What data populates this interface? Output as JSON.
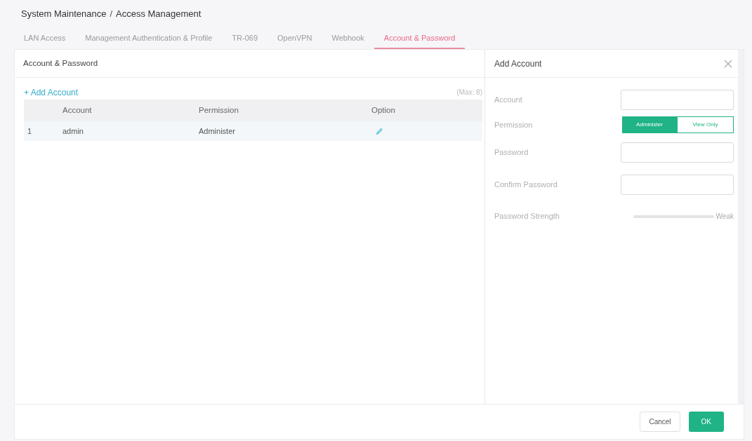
{
  "breadcrumb": {
    "items": [
      "System Maintenance",
      "Access Management"
    ],
    "separator": "/"
  },
  "tabs": [
    {
      "label": "LAN Access",
      "selected": false
    },
    {
      "label": "Management Authentication & Profile",
      "selected": false
    },
    {
      "label": "TR-069",
      "selected": false
    },
    {
      "label": "OpenVPN",
      "selected": false
    },
    {
      "label": "Webhook",
      "selected": false
    },
    {
      "label": "Account & Password",
      "selected": true
    }
  ],
  "account_panel": {
    "title": "Account & Password",
    "add_link": "+ Add Account",
    "max_note": "(Max: 8)",
    "table": {
      "columns": [
        "Account",
        "Permission",
        "Option"
      ],
      "rows": [
        {
          "index": "1",
          "account": "admin",
          "permission": "Administer"
        }
      ]
    }
  },
  "add_account": {
    "title": "Add Account",
    "fields": [
      {
        "kind": "input",
        "label": "Account"
      },
      {
        "kind": "segmented",
        "label": "Permission",
        "options": [
          {
            "label": "Administer",
            "selected": true
          },
          {
            "label": "View Only",
            "selected": false
          }
        ]
      },
      {
        "kind": "input",
        "label": "Password"
      },
      {
        "kind": "input",
        "label": "Confirm Password"
      },
      {
        "kind": "strength",
        "label": "Password Strength",
        "level": 0,
        "reading": "Weak"
      }
    ]
  },
  "buttons": [
    {
      "kind": "secondary",
      "label": "Cancel"
    },
    {
      "kind": "primary",
      "label": "OK"
    }
  ]
}
